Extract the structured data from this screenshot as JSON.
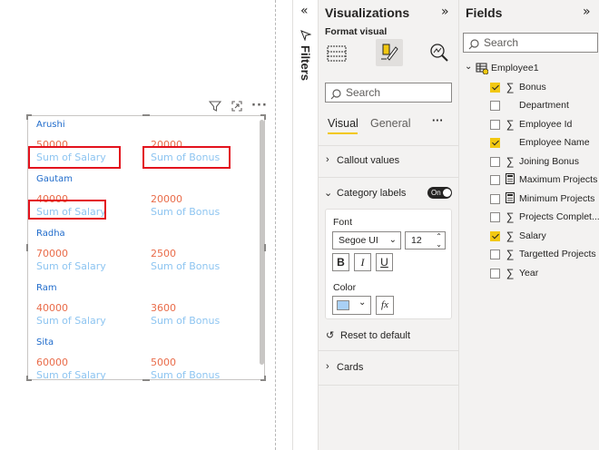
{
  "visual": {
    "cards": [
      {
        "category": "Arushi",
        "salary": "50000",
        "bonus": "20000"
      },
      {
        "category": "Gautam",
        "salary": "40000",
        "bonus": "20000"
      },
      {
        "category": "Radha",
        "salary": "70000",
        "bonus": "2500"
      },
      {
        "category": "Ram",
        "salary": "40000",
        "bonus": "3600"
      },
      {
        "category": "Sita",
        "salary": "60000",
        "bonus": "5000"
      }
    ],
    "salary_label": "Sum of Salary",
    "bonus_label": "Sum of Bonus",
    "icons": {
      "filter": "filter-icon",
      "focus": "focus-mode-icon",
      "more": "more-options-icon"
    }
  },
  "filters": {
    "label": "Filters"
  },
  "visualizations": {
    "title": "Visualizations",
    "format_visual": "Format visual",
    "search_placeholder": "Search",
    "tabs": [
      "Visual",
      "General"
    ],
    "more": "···",
    "sections": {
      "callout_values": "Callout values",
      "category_labels": "Category labels",
      "toggle": "On",
      "reset": "Reset to default",
      "cards": "Cards"
    },
    "font": {
      "label": "Font",
      "family": "Segoe UI",
      "size": "12",
      "bold": "B",
      "italic": "I",
      "underline": "U",
      "color_label": "Color",
      "color_value": "#a9d0f5",
      "fx": "fx"
    }
  },
  "fields": {
    "title": "Fields",
    "search_placeholder": "Search",
    "table": "Employee1",
    "items": [
      {
        "name": "Bonus",
        "checked": true,
        "icon": "sigma"
      },
      {
        "name": "Department",
        "checked": false,
        "icon": "none"
      },
      {
        "name": "Employee Id",
        "checked": false,
        "icon": "sigma"
      },
      {
        "name": "Employee Name",
        "checked": true,
        "icon": "none"
      },
      {
        "name": "Joining Bonus",
        "checked": false,
        "icon": "sigma"
      },
      {
        "name": "Maximum Projects",
        "checked": false,
        "icon": "calculator"
      },
      {
        "name": "Minimum Projects",
        "checked": false,
        "icon": "calculator"
      },
      {
        "name": "Projects Complet...",
        "checked": false,
        "icon": "sigma"
      },
      {
        "name": "Salary",
        "checked": true,
        "icon": "sigma"
      },
      {
        "name": "Targetted Projects",
        "checked": false,
        "icon": "sigma"
      },
      {
        "name": "Year",
        "checked": false,
        "icon": "sigma"
      }
    ]
  },
  "colors": {
    "accent": "#f2c811",
    "value": "#e96c4a",
    "label": "#8ec5f1",
    "category": "#1f6bcb",
    "highlight": "#e3121d"
  }
}
